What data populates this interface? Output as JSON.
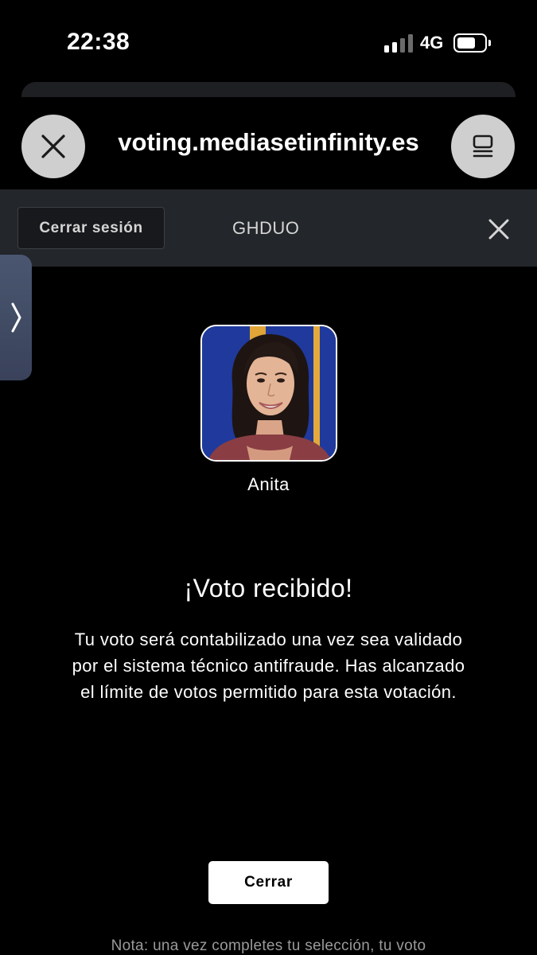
{
  "status_bar": {
    "time": "22:38",
    "network": "4G",
    "signal_bars_active": 2,
    "signal_bars_total": 4,
    "battery_level": 0.7
  },
  "browser": {
    "url": "voting.mediasetinfinity.es",
    "close_icon": "close-icon",
    "reader_icon": "reader-mode-icon"
  },
  "site_header": {
    "logout_label": "Cerrar sesión",
    "user_code": "GHDUO",
    "close_icon": "close-icon"
  },
  "side_tab": {
    "icon": "chevron-right-icon"
  },
  "candidate": {
    "name": "Anita"
  },
  "confirmation": {
    "title": "¡Voto recibido!",
    "message": "Tu voto será contabilizado una vez sea validado por el sistema técnico antifraude. Has alcanzado el límite de votos permitido para esta votación.",
    "close_label": "Cerrar",
    "note": "Nota: una vez completes tu selección, tu voto"
  },
  "colors": {
    "background": "#000000",
    "site_bar": "#23262a",
    "button_bg": "#ffffff",
    "avatar_bg": "#1f3a9c"
  }
}
